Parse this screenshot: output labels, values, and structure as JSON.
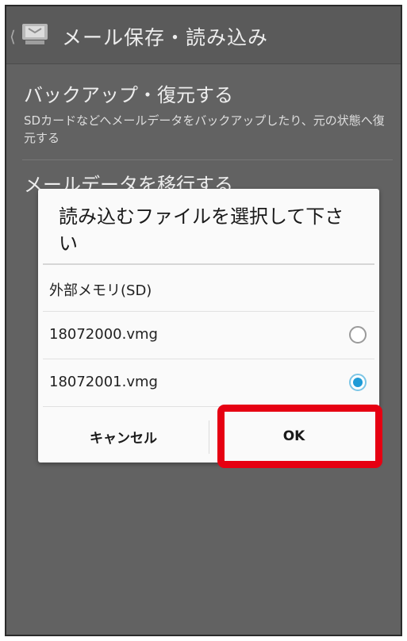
{
  "app_bar": {
    "title": "メール保存・読み込み",
    "back_icon": "chevron-left-icon",
    "app_icon": "mail-app-icon"
  },
  "settings": [
    {
      "title": "バックアップ・復元する",
      "description": "SDカードなどへメールデータをバックアップしたり、元の状態へ復元する"
    },
    {
      "title": "メールデータを移行する"
    }
  ],
  "dialog": {
    "title": "読み込むファイルを選択して下さい",
    "section_header": "外部メモリ(SD)",
    "options": [
      {
        "label": "18072000.vmg",
        "selected": false
      },
      {
        "label": "18072001.vmg",
        "selected": true
      }
    ],
    "cancel_label": "キャンセル",
    "ok_label": "OK"
  },
  "colors": {
    "radio_selected": "#1e9bd7",
    "highlight": "#e60012",
    "background_dim": "#626262"
  }
}
